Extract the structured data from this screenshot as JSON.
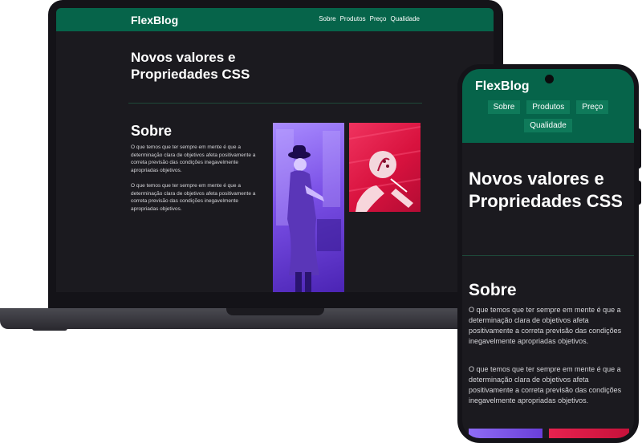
{
  "site": {
    "logo": "FlexBlog",
    "nav": [
      "Sobre",
      "Produtos",
      "Preço",
      "Qualidade"
    ],
    "hero_title": "Novos valores e Propriedades CSS",
    "about_title": "Sobre",
    "paragraphs": [
      "O que temos que ter sempre em mente é que a determinação clara de objetivos afeta positivamente a correta previsão das condições inegavelmente apropriadas objetivos.",
      "O que temos que ter sempre em mente é que a determinação clara de objetivos afeta positivamente a correta previsão das condições inegavelmente apropriadas objetivos."
    ]
  },
  "colors": {
    "header": "#06644a",
    "background": "#1b1a1f",
    "device_frame": "#141318",
    "image_purple": "#7a4fe6",
    "image_red": "#e8224f"
  }
}
